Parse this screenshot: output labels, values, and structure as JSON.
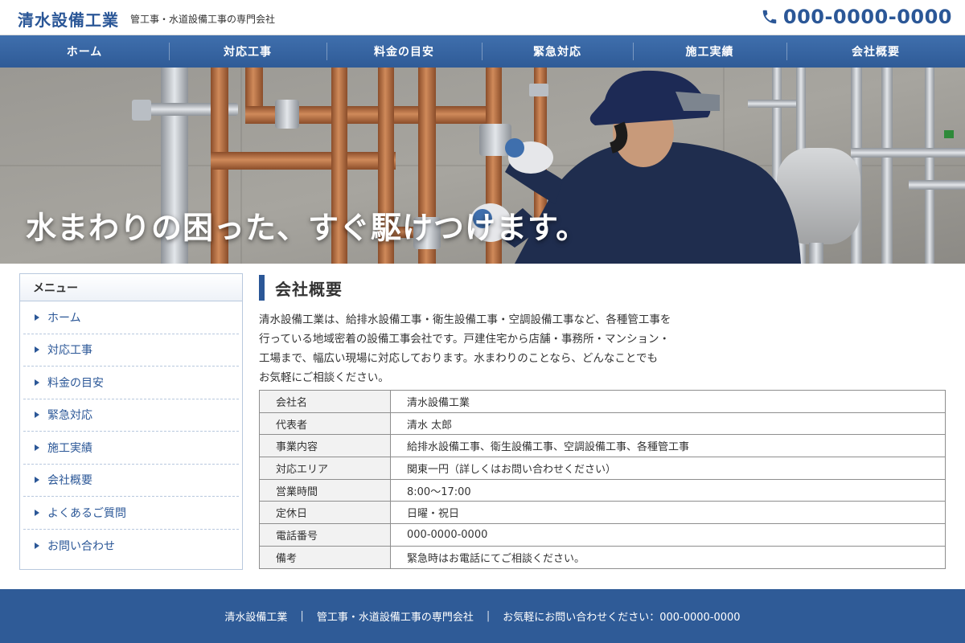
{
  "header": {
    "logo": "清水設備工業",
    "tagline": "管工事・水道設備工事の専門会社",
    "phone": "000-0000-0000"
  },
  "nav": {
    "items": [
      {
        "label": "ホーム"
      },
      {
        "label": "対応工事"
      },
      {
        "label": "料金の目安"
      },
      {
        "label": "緊急対応"
      },
      {
        "label": "施工実績"
      },
      {
        "label": "会社概要"
      }
    ]
  },
  "hero": {
    "title": "水まわりの困った、すぐ駆けつけます。"
  },
  "sidebar": {
    "title": "メニュー",
    "items": [
      {
        "label": "ホーム"
      },
      {
        "label": "対応工事"
      },
      {
        "label": "料金の目安"
      },
      {
        "label": "緊急対応"
      },
      {
        "label": "施工実績"
      },
      {
        "label": "会社概要"
      },
      {
        "label": "よくあるご質問"
      },
      {
        "label": "お問い合わせ"
      }
    ]
  },
  "main": {
    "title": "会社概要",
    "intro_lines": [
      "清水設備工業は、給排水設備工事・衛生設備工事・空調設備工事など、各種管工事を",
      "行っている地域密着の設備工事会社です。戸建住宅から店舗・事務所・マンション・",
      "工場まで、幅広い現場に対応しております。水まわりのことなら、どんなことでも",
      "お気軽にご相談ください。"
    ],
    "table": [
      {
        "label": "会社名",
        "value": "清水設備工業"
      },
      {
        "label": "代表者",
        "value": "清水 太郎"
      },
      {
        "label": "事業内容",
        "value": "給排水設備工事、衛生設備工事、空調設備工事、各種管工事"
      },
      {
        "label": "対応エリア",
        "value": "関東一円（詳しくはお問い合わせください）"
      },
      {
        "label": "営業時間",
        "value": "8:00〜17:00"
      },
      {
        "label": "定休日",
        "value": "日曜・祝日"
      },
      {
        "label": "電話番号",
        "value": "000-0000-0000"
      },
      {
        "label": "備考",
        "value": "緊急時はお電話にてご相談ください。"
      }
    ]
  },
  "footer": {
    "company": "清水設備工業",
    "tagline": "管工事・水道設備工事の専門会社",
    "contact": "お気軽にお問い合わせください：000-0000-0000"
  },
  "colors": {
    "brand": "#2b5797",
    "nav": "#2f5b97",
    "footer": "#2f5b97",
    "copper": "#b8703f"
  },
  "icons": {
    "phone": "phone-icon",
    "menu_arrow": "triangle-right-icon"
  }
}
